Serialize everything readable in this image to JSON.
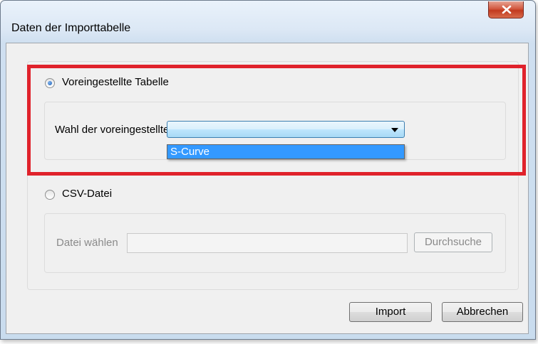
{
  "window": {
    "title": "Daten der Importtabelle"
  },
  "preset": {
    "radio_label": "Voreingestellte Tabelle",
    "selected": true,
    "combo_label": "Wahl der voreingestellten Tabelle:",
    "combo_value": "",
    "options": [
      "S-Curve"
    ]
  },
  "csv": {
    "radio_label": "CSV-Datei",
    "selected": false,
    "file_label": "Datei wählen",
    "file_value": "",
    "browse_label": "Durchsuche"
  },
  "buttons": {
    "import": "Import",
    "cancel": "Abbrechen"
  },
  "colors": {
    "highlight_border": "#e0222b",
    "selection": "#3399ff"
  }
}
